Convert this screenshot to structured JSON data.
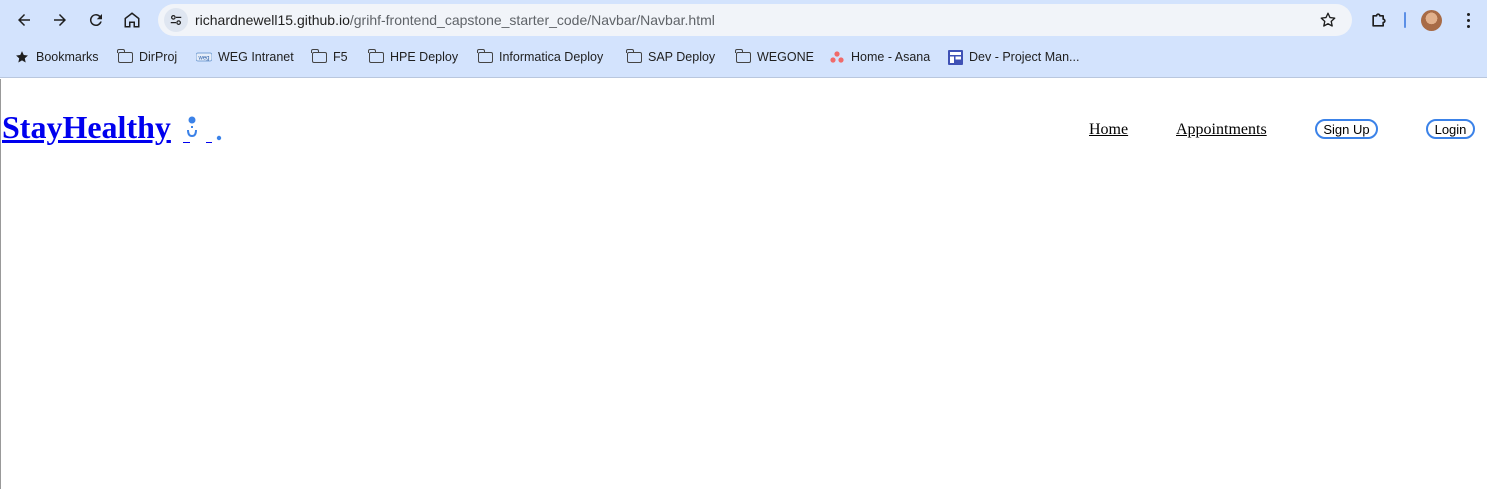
{
  "browser": {
    "url_host": "richardnewell15.github.io",
    "url_path": "/grihf-frontend_capstone_starter_code/Navbar/Navbar.html"
  },
  "bookmarks": [
    {
      "label": "Bookmarks",
      "icon": "star-icon"
    },
    {
      "label": "DirProj",
      "icon": "folder-icon"
    },
    {
      "label": "WEG Intranet",
      "icon": "weg-logo-icon"
    },
    {
      "label": "F5",
      "icon": "folder-icon"
    },
    {
      "label": "HPE Deploy",
      "icon": "folder-icon"
    },
    {
      "label": "Informatica Deploy",
      "icon": "folder-icon"
    },
    {
      "label": "SAP Deploy",
      "icon": "folder-icon"
    },
    {
      "label": "WEGONE",
      "icon": "folder-icon"
    },
    {
      "label": "Home - Asana",
      "icon": "asana-icon"
    },
    {
      "label": "Dev - Project Man...",
      "icon": "project-board-icon"
    }
  ],
  "navbar": {
    "brand": "StayHealthy",
    "links": [
      {
        "label": "Home"
      },
      {
        "label": "Appointments"
      }
    ],
    "buttons": [
      {
        "label": "Sign Up"
      },
      {
        "label": "Login"
      }
    ]
  },
  "colors": {
    "chrome_bg": "#d3e3fd",
    "link_blue": "#0000ee",
    "button_border": "#3b82e8"
  }
}
